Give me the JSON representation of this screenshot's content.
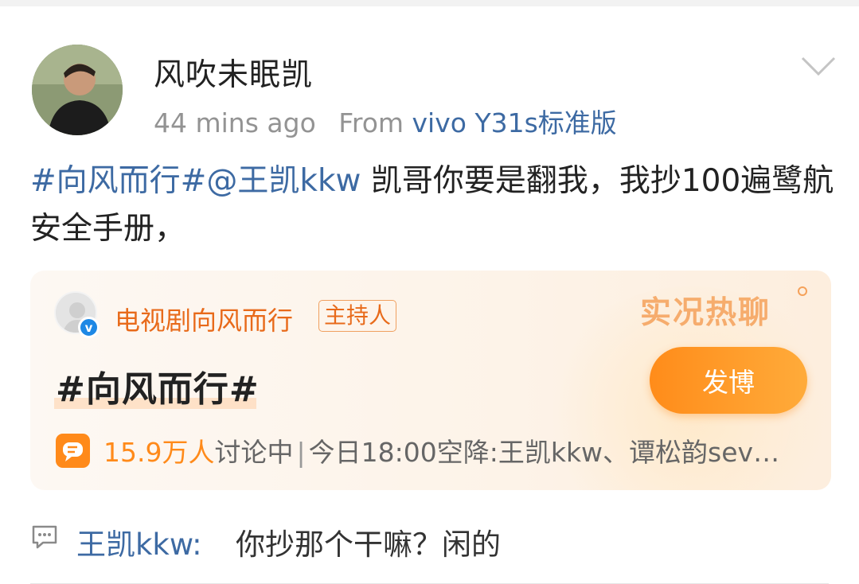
{
  "post": {
    "author": "风吹未眠凯",
    "time": "44 mins ago",
    "from_label": "From",
    "device": "vivo Y31s标准版",
    "body_link": "#向风而行#@王凯kkw",
    "body_text": " 凯哥你要是翻我，我抄100遍鹭航安全手册，"
  },
  "topic_card": {
    "host_name": "电视剧向风而行",
    "host_badge": "主持人",
    "live_label": "实况热聊",
    "title": "#向风而行#",
    "post_button": "发博",
    "count": "15.9万人",
    "discussing": "讨论中",
    "separator": "|",
    "schedule": "今日18:00空降:王凯kkw、谭松韵sev…"
  },
  "comment": {
    "user": "王凯kkw",
    "text": "你抄那个干嘛？闲的"
  },
  "icons": {
    "chevron": "chevron-down-icon",
    "verified": "verified-icon",
    "chat": "chat-bubble-icon",
    "comment": "comment-icon"
  },
  "colors": {
    "link": "#3d6aa3",
    "accent": "#ff8a1a",
    "host": "#e86a1a"
  }
}
